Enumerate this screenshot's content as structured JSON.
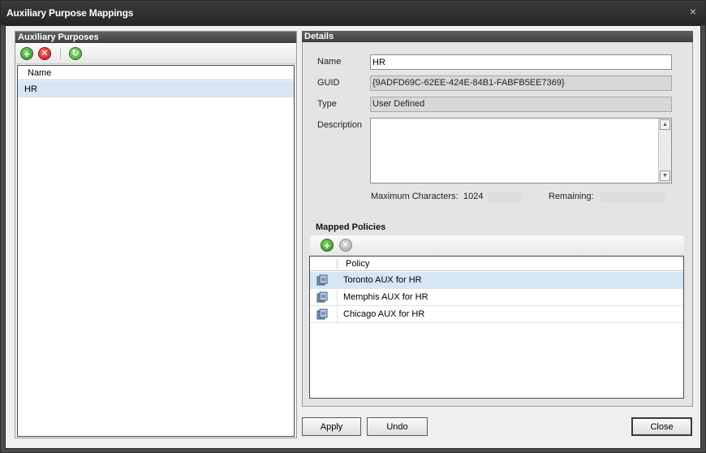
{
  "window": {
    "title": "Auxiliary Purpose Mappings",
    "close_glyph": "×"
  },
  "left_panel": {
    "title": "Auxiliary Purposes",
    "toolbar": {
      "add_icon": "add-icon",
      "delete_icon": "delete-icon",
      "refresh_icon": "refresh-icon"
    },
    "column_header": "Name",
    "items": [
      {
        "label": "HR",
        "selected": true
      }
    ]
  },
  "details": {
    "title": "Details",
    "name_label": "Name",
    "name_value": "HR",
    "guid_label": "GUID",
    "guid_value": "{9ADFD69C-62EE-424E-84B1-FABFB5EE7369}",
    "type_label": "Type",
    "type_value": "User Defined",
    "description_label": "Description",
    "description_value": "",
    "max_chars_label": "Maximum Characters:",
    "max_chars_value": "1024",
    "remaining_label": "Remaining:",
    "remaining_value": ""
  },
  "mapped_policies": {
    "title": "Mapped Policies",
    "column_header": "Policy",
    "rows": [
      {
        "label": "Toronto AUX for HR",
        "selected": true,
        "icon": "policy-icon"
      },
      {
        "label": "Memphis AUX for HR",
        "selected": false,
        "icon": "policy-icon"
      },
      {
        "label": "Chicago AUX for HR",
        "selected": false,
        "icon": "policy-icon"
      }
    ]
  },
  "buttons": {
    "apply": "Apply",
    "undo": "Undo",
    "close": "Close"
  },
  "colors": {
    "selection": "#d6e6f5",
    "header_dark": "#4a4a4a",
    "add_green": "#2f8f20",
    "delete_red": "#c11616"
  }
}
